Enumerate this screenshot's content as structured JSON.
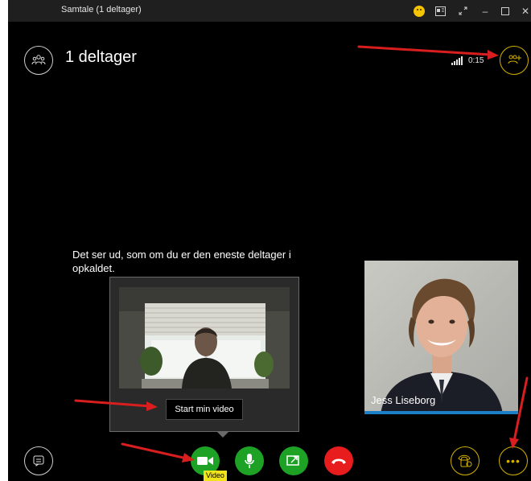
{
  "window": {
    "title": "Samtale (1 deltager)"
  },
  "header": {
    "participant_count_label": "1 deltager",
    "timer": "0:15"
  },
  "stage": {
    "message": "Det ser ud, som om du er den eneste deltager i opkaldet."
  },
  "self_view": {
    "start_video_label": "Start min video"
  },
  "participant": {
    "name": "Jess Liseborg"
  },
  "controls": {
    "tooltip": "Video",
    "icons": [
      "chat-icon",
      "video-icon",
      "microphone-icon",
      "share-screen-icon",
      "hangup-icon",
      "call-controls-icon",
      "more-icon",
      "participants-icon",
      "add-people-icon"
    ]
  },
  "colors": {
    "call_green": "#1ea226",
    "hangup_red": "#e81c1c",
    "accent_yellow": "#d4b000",
    "active_blue": "#1c7fc7"
  }
}
